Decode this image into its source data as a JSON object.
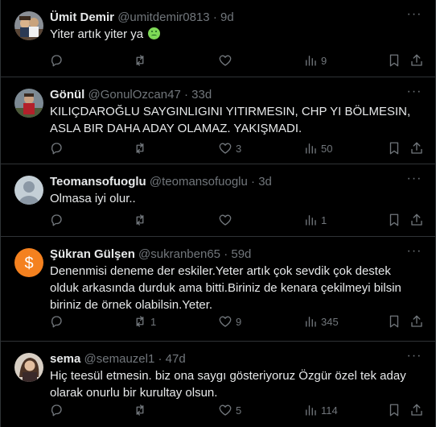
{
  "tweets": [
    {
      "name": "Ümit Demir",
      "handle": "@umitdemir0813",
      "time": "9d",
      "text": "Yiter artık yiter ya",
      "emoji": "nauseated-face",
      "replies": "",
      "retweets": "",
      "likes": "",
      "views": "9"
    },
    {
      "name": "Gönül",
      "handle": "@GonulOzcan47",
      "time": "33d",
      "text": "KILIÇDAROĞLU SAYGINLIGINI YITIRMESIN, CHP YI BÖLMESIN, ASLA BIR DAHA ADAY OLAMAZ. YAKIŞMADI.",
      "replies": "",
      "retweets": "",
      "likes": "3",
      "views": "50"
    },
    {
      "name": "Teomansofuoglu",
      "handle": "@teomansofuoglu",
      "time": "3d",
      "text": "Olmasa iyi olur..",
      "replies": "",
      "retweets": "",
      "likes": "",
      "views": "1"
    },
    {
      "name": "Şükran Gülşen",
      "handle": "@sukranben65",
      "time": "59d",
      "text": "Denenmisi deneme der eskiler.Yeter artık çok sevdik çok destek olduk arkasında durduk ama bitti.Biriniz de kenara çekilmeyi bilsin biriniz de örnek olabilsin.Yeter.",
      "replies": "",
      "retweets": "1",
      "likes": "9",
      "views": "345"
    },
    {
      "name": "sema",
      "handle": "@semauzel1",
      "time": "47d",
      "text": "Hiç teesül etmesin. biz ona saygı gösteriyoruz Özgür özel  tek aday olarak onurlu bir kurultay olsun.",
      "replies": "",
      "retweets": "",
      "likes": "5",
      "views": "114"
    }
  ],
  "separator": "·",
  "more_label": "···",
  "icons": {
    "reply": "reply-icon",
    "retweet": "retweet-icon",
    "like": "heart-icon",
    "views": "views-icon",
    "bookmark": "bookmark-icon",
    "share": "share-icon"
  },
  "colors": {
    "background": "#000000",
    "text": "#e7e9ea",
    "muted": "#71767b",
    "border": "#2f3336",
    "sukran_avatar": "#f4811f"
  }
}
